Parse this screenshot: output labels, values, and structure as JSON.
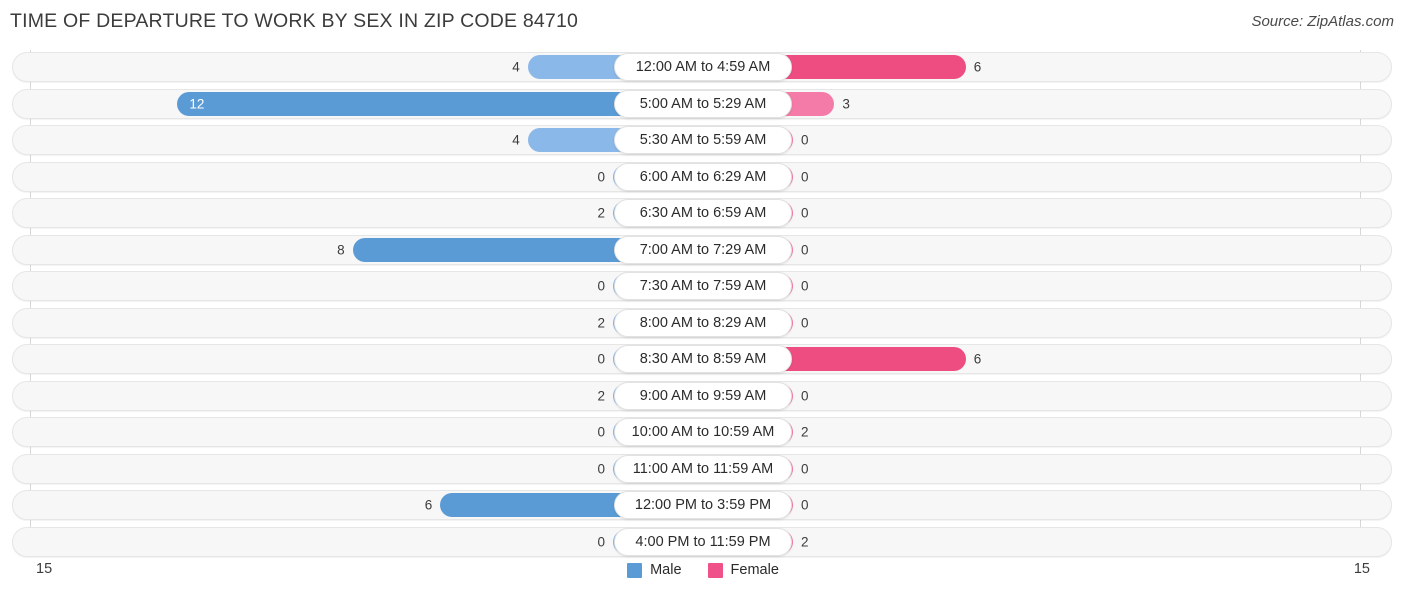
{
  "header": {
    "title": "TIME OF DEPARTURE TO WORK BY SEX IN ZIP CODE 84710",
    "source": "Source: ZipAtlas.com"
  },
  "axis": {
    "left_label": "15",
    "right_label": "15",
    "max": 15
  },
  "legend": {
    "male_label": "Male",
    "female_label": "Female",
    "male_color": "#5b9bd5",
    "female_color": "#ee5288"
  },
  "colors": {
    "male_light": "#8ab8e8",
    "male_strong": "#5b9bd5",
    "female_light": "#f47ba7",
    "female_strong": "#ee4d81",
    "track": "#f7f7f7",
    "gridline": "#d8d8d8"
  },
  "chart_data": {
    "type": "bar",
    "title": "TIME OF DEPARTURE TO WORK BY SEX IN ZIP CODE 84710",
    "subtitle": "Source: ZipAtlas.com",
    "orientation": "horizontal-diverging",
    "xlabel": "",
    "ylabel": "",
    "xlim": [
      15,
      15
    ],
    "grid": true,
    "legend_position": "bottom-center",
    "categories": [
      "12:00 AM to 4:59 AM",
      "5:00 AM to 5:29 AM",
      "5:30 AM to 5:59 AM",
      "6:00 AM to 6:29 AM",
      "6:30 AM to 6:59 AM",
      "7:00 AM to 7:29 AM",
      "7:30 AM to 7:59 AM",
      "8:00 AM to 8:29 AM",
      "8:30 AM to 8:59 AM",
      "9:00 AM to 9:59 AM",
      "10:00 AM to 10:59 AM",
      "11:00 AM to 11:59 AM",
      "12:00 PM to 3:59 PM",
      "4:00 PM to 11:59 PM"
    ],
    "series": [
      {
        "name": "Male",
        "values": [
          4,
          12,
          4,
          0,
          2,
          8,
          0,
          2,
          0,
          2,
          0,
          0,
          6,
          0
        ]
      },
      {
        "name": "Female",
        "values": [
          6,
          3,
          0,
          0,
          0,
          0,
          0,
          0,
          6,
          0,
          2,
          0,
          0,
          2
        ]
      }
    ]
  },
  "rows": [
    {
      "label": "12:00 AM to 4:59 AM",
      "male": "4",
      "female": "6"
    },
    {
      "label": "5:00 AM to 5:29 AM",
      "male": "12",
      "female": "3"
    },
    {
      "label": "5:30 AM to 5:59 AM",
      "male": "4",
      "female": "0"
    },
    {
      "label": "6:00 AM to 6:29 AM",
      "male": "0",
      "female": "0"
    },
    {
      "label": "6:30 AM to 6:59 AM",
      "male": "2",
      "female": "0"
    },
    {
      "label": "7:00 AM to 7:29 AM",
      "male": "8",
      "female": "0"
    },
    {
      "label": "7:30 AM to 7:59 AM",
      "male": "0",
      "female": "0"
    },
    {
      "label": "8:00 AM to 8:29 AM",
      "male": "2",
      "female": "0"
    },
    {
      "label": "8:30 AM to 8:59 AM",
      "male": "0",
      "female": "6"
    },
    {
      "label": "9:00 AM to 9:59 AM",
      "male": "2",
      "female": "0"
    },
    {
      "label": "10:00 AM to 10:59 AM",
      "male": "0",
      "female": "2"
    },
    {
      "label": "11:00 AM to 11:59 AM",
      "male": "0",
      "female": "0"
    },
    {
      "label": "12:00 PM to 3:59 PM",
      "male": "6",
      "female": "0"
    },
    {
      "label": "4:00 PM to 11:59 PM",
      "male": "0",
      "female": "2"
    }
  ]
}
